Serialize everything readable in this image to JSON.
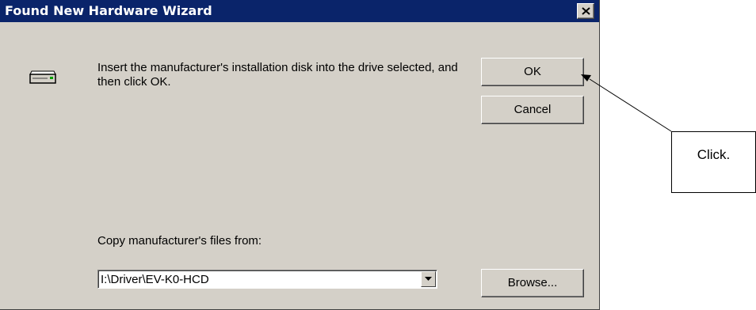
{
  "window": {
    "title": "Found New Hardware Wizard",
    "close_label": "×"
  },
  "dialog": {
    "message": "Insert the manufacturer's installation disk into the drive selected, and then click OK.",
    "icon": "disk-drive-icon",
    "copy_label": "Copy manufacturer's files from:",
    "path_value": "I:\\Driver\\EV-K0-HCD",
    "buttons": {
      "ok": "OK",
      "cancel": "Cancel",
      "browse": "Browse..."
    }
  },
  "annotation": {
    "text": "Click."
  },
  "colors": {
    "titlebar": "#0a246a",
    "dialog_bg": "#d4d0c8"
  }
}
